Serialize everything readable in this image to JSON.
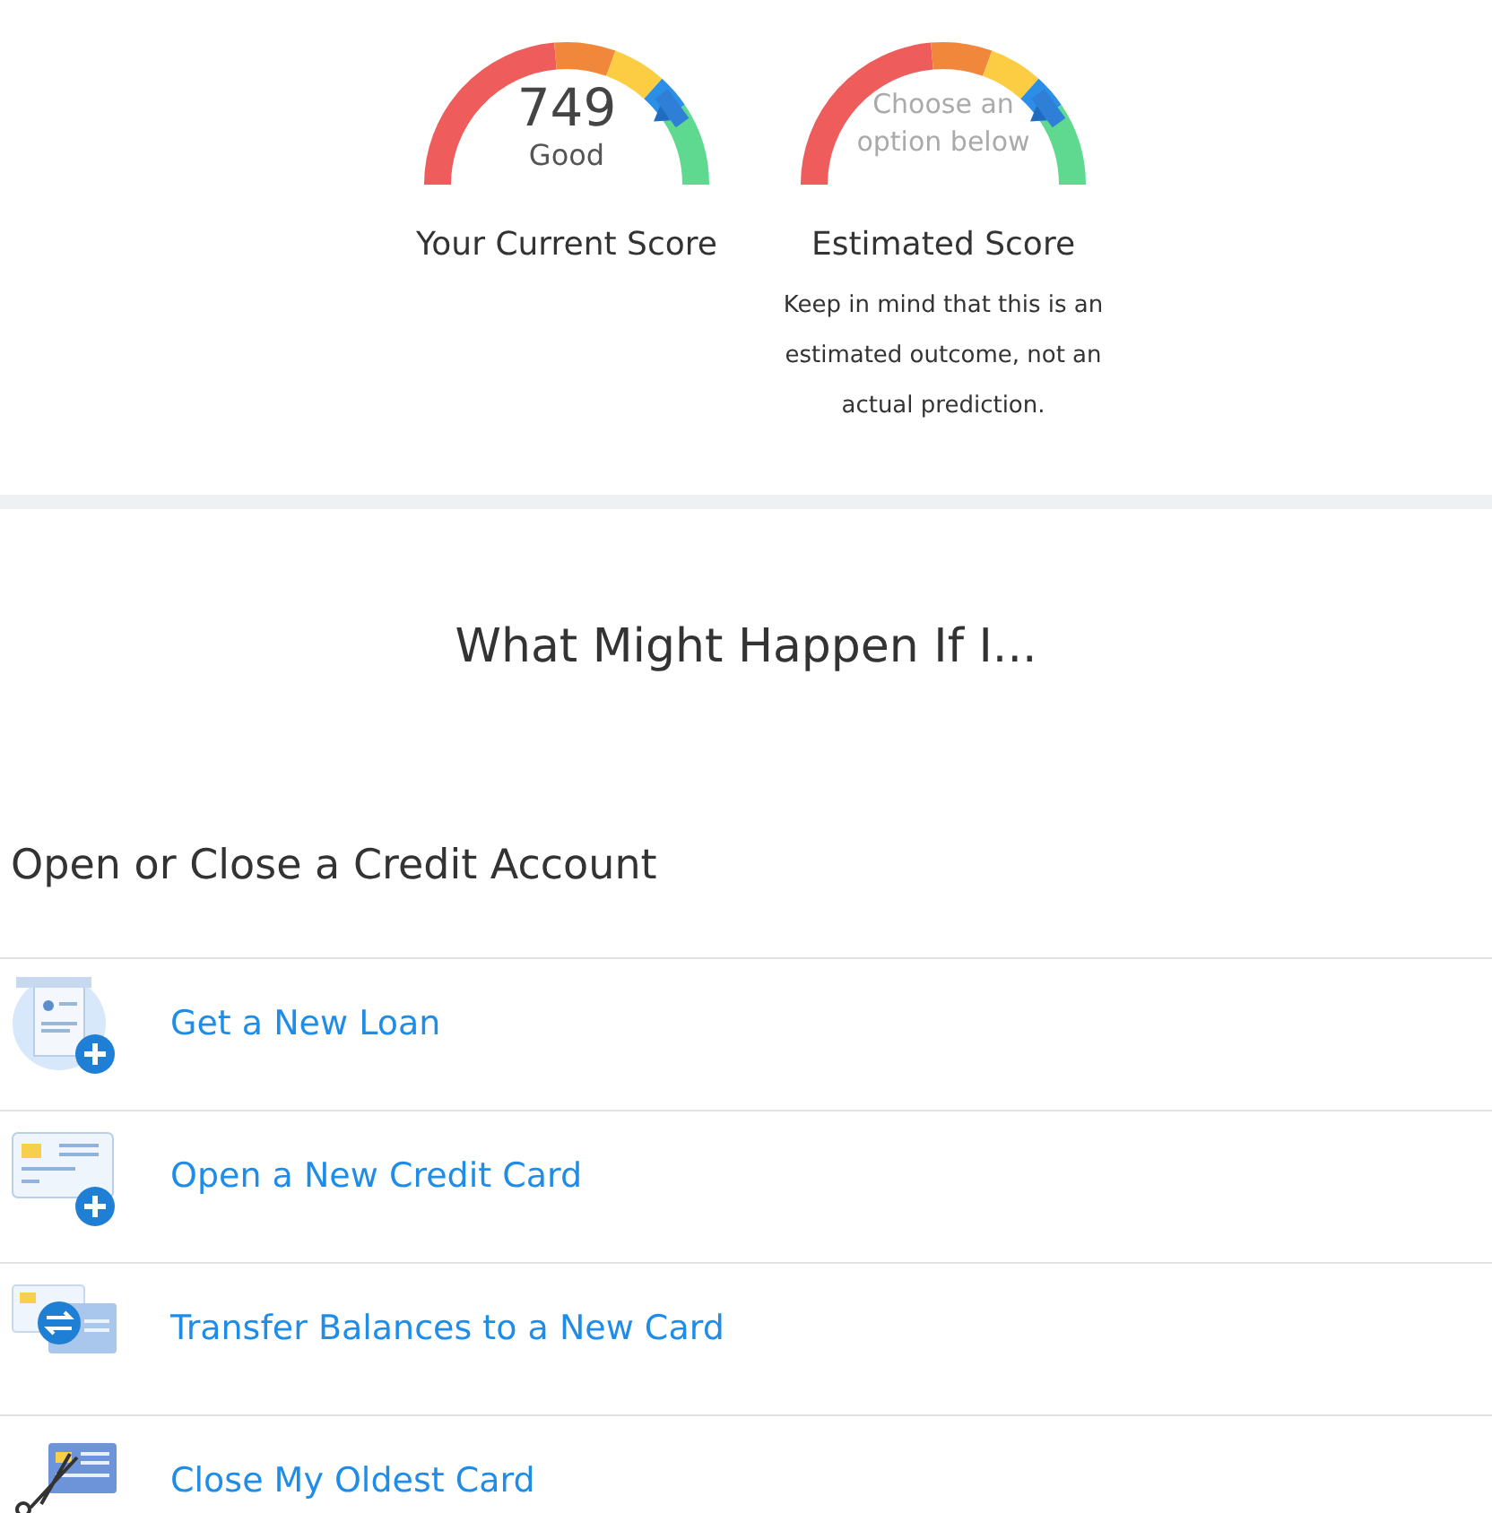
{
  "gauges": [
    {
      "kind": "score",
      "value": "749",
      "rating": "Good",
      "label": "Your Current Score"
    },
    {
      "kind": "placeholder",
      "hint": "Choose an option below",
      "label": "Estimated Score",
      "note": "Keep in mind that this is an estimated outcome, not an actual prediction."
    }
  ],
  "heading": "What Might Happen If I...",
  "section": {
    "title": "Open or Close a Credit Account",
    "items": [
      {
        "kind": "loan",
        "label": "Get a New Loan"
      },
      {
        "kind": "new-card",
        "label": "Open a New Credit Card"
      },
      {
        "kind": "transfer",
        "label": "Transfer Balances to a New Card"
      },
      {
        "kind": "close-card",
        "label": "Close My Oldest Card"
      }
    ]
  }
}
